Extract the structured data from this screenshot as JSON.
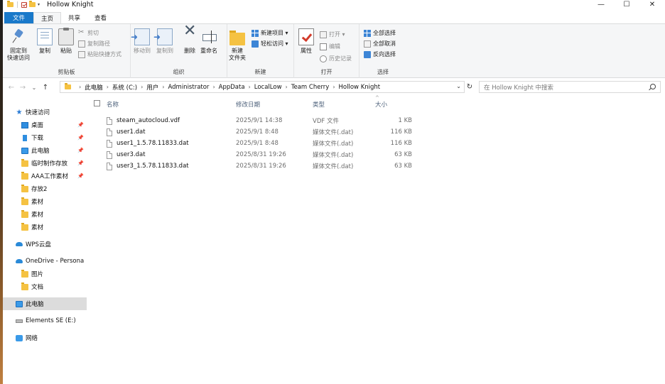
{
  "window": {
    "title": "Hollow Knight"
  },
  "window_controls": {
    "minimize": "—",
    "maximize": "☐",
    "close": "✕"
  },
  "tabs": [
    "文件",
    "主页",
    "共享",
    "查看"
  ],
  "ribbon": {
    "clipboard": {
      "label": "剪贴板",
      "pin_l1": "固定到",
      "pin_l2": "快速访问",
      "copy": "复制",
      "paste": "粘贴",
      "cut": "剪切",
      "copy_path": "复制路径",
      "paste_shortcut": "粘贴快捷方式"
    },
    "organize": {
      "label": "组织",
      "move_to": "移动到",
      "copy_to": "复制到",
      "delete": "删除",
      "rename": "重命名"
    },
    "new": {
      "label": "新建",
      "new_folder_l1": "新建",
      "new_folder_l2": "文件夹",
      "new_item": "新建项目 ▾",
      "easy_access": "轻松访问 ▾"
    },
    "open": {
      "label": "打开",
      "properties": "属性",
      "open": "打开 ▾",
      "edit": "编辑",
      "history": "历史记录"
    },
    "select": {
      "label": "选择",
      "select_all": "全部选择",
      "select_none": "全部取消",
      "invert": "反向选择"
    }
  },
  "nav": {
    "back": "←",
    "forward": "→",
    "recent": "⌄",
    "up": "↑",
    "refresh": "↻"
  },
  "address": {
    "breadcrumbs": [
      "此电脑",
      "系统 (C:)",
      "用户",
      "Administrator",
      "AppData",
      "LocalLow",
      "Team Cherry",
      "Hollow Knight"
    ],
    "sep": "›"
  },
  "search": {
    "placeholder": "在 Hollow Knight 中搜索"
  },
  "sidebar": [
    {
      "label": "快速访问",
      "icon": "star-icon"
    },
    {
      "label": "桌面",
      "icon": "desktop-icon",
      "pinned": true
    },
    {
      "label": "下载",
      "icon": "download-icon",
      "pinned": true
    },
    {
      "label": "此电脑",
      "icon": "pc-icon",
      "pinned": true
    },
    {
      "label": "临时制作存放",
      "icon": "folder-icon",
      "pinned": true
    },
    {
      "label": "AAA工作素材",
      "icon": "folder-icon",
      "pinned": true
    },
    {
      "label": "存放2",
      "icon": "folder-icon"
    },
    {
      "label": "素材",
      "icon": "folder-icon"
    },
    {
      "label": "素材",
      "icon": "folder-icon"
    },
    {
      "label": "素材",
      "icon": "folder-icon"
    },
    {
      "label": "WPS云盘",
      "icon": "cloud-icon"
    },
    {
      "label": "OneDrive - Persona",
      "icon": "cloud-icon"
    },
    {
      "label": "图片",
      "icon": "folder-icon"
    },
    {
      "label": "文档",
      "icon": "folder-icon"
    },
    {
      "label": "此电脑",
      "icon": "pc-icon",
      "selected": true
    },
    {
      "label": "Elements SE (E:)",
      "icon": "drive-icon"
    },
    {
      "label": "网络",
      "icon": "network-icon"
    }
  ],
  "pin_glyph": "📌",
  "columns": {
    "name": "名称",
    "date": "修改日期",
    "type": "类型",
    "size": "大小",
    "sort_arrow": "^"
  },
  "files": [
    {
      "name": "steam_autocloud.vdf",
      "date": "2025/9/1 14:38",
      "type": "VDF 文件",
      "size": "1 KB"
    },
    {
      "name": "user1.dat",
      "date": "2025/9/1 8:48",
      "type": "媒体文件(.dat)",
      "size": "116 KB"
    },
    {
      "name": "user1_1.5.78.11833.dat",
      "date": "2025/9/1 8:48",
      "type": "媒体文件(.dat)",
      "size": "116 KB"
    },
    {
      "name": "user3.dat",
      "date": "2025/8/31 19:26",
      "type": "媒体文件(.dat)",
      "size": "63 KB"
    },
    {
      "name": "user3_1.5.78.11833.dat",
      "date": "2025/8/31 19:26",
      "type": "媒体文件(.dat)",
      "size": "63 KB"
    }
  ]
}
